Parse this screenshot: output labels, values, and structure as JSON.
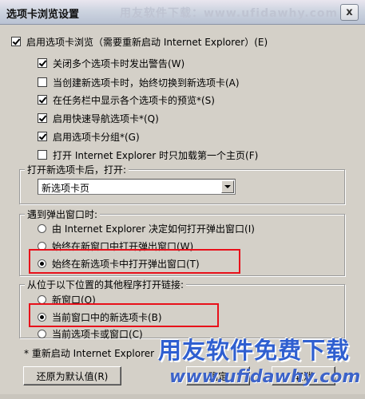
{
  "window": {
    "title": "选项卡浏览设置",
    "watermark_top": "用友软件下载：www.ufidawhy.com",
    "close_label": "x"
  },
  "enable_tabs": {
    "label": "启用选项卡浏览（需要重新启动 Internet Explorer）(E)",
    "checked": true
  },
  "options": [
    {
      "label": "关闭多个选项卡时发出警告(W)",
      "checked": true
    },
    {
      "label": "当创建新选项卡时，始终切换到新选项卡(A)",
      "checked": false
    },
    {
      "label": "在任务栏中显示各个选项卡的预览*(S)",
      "checked": true
    },
    {
      "label": "启用快速导航选项卡*(Q)",
      "checked": true
    },
    {
      "label": "启用选项卡分组*(G)",
      "checked": true
    },
    {
      "label": "打开 Internet Explorer 时只加载第一个主页(F)",
      "checked": false
    }
  ],
  "new_tab_group": {
    "label": "打开新选项卡后，打开:",
    "selected": "新选项卡页"
  },
  "popup_group": {
    "label": "遇到弹出窗口时:",
    "options": [
      {
        "label": "由 Internet Explorer 决定如何打开弹出窗口(I)",
        "selected": false
      },
      {
        "label": "始终在新窗口中打开弹出窗口(W)",
        "selected": false
      },
      {
        "label": "始终在新选项卡中打开弹出窗口(T)",
        "selected": true
      }
    ]
  },
  "links_group": {
    "label": "从位于以下位置的其他程序打开链接:",
    "options": [
      {
        "label": "新窗口(O)",
        "selected": false
      },
      {
        "label": "当前窗口中的新选项卡(B)",
        "selected": true
      },
      {
        "label": "当前选项卡或窗口(C)",
        "selected": false
      }
    ]
  },
  "footnote": "* 重新启动 Internet Explorer",
  "buttons": {
    "restore_defaults": "还原为默认值(R)",
    "ok": "确定",
    "cancel": "取消"
  },
  "watermark_bottom": {
    "cn": "用友软件免费下载",
    "url": "www.ufidawhy.com"
  },
  "colors": {
    "highlight": "#e8101a",
    "dialog_bg": "#d4d0c8",
    "watermark_blue": "#2f5fd0"
  },
  "icons": [
    "close-icon",
    "dropdown-arrow-icon"
  ]
}
